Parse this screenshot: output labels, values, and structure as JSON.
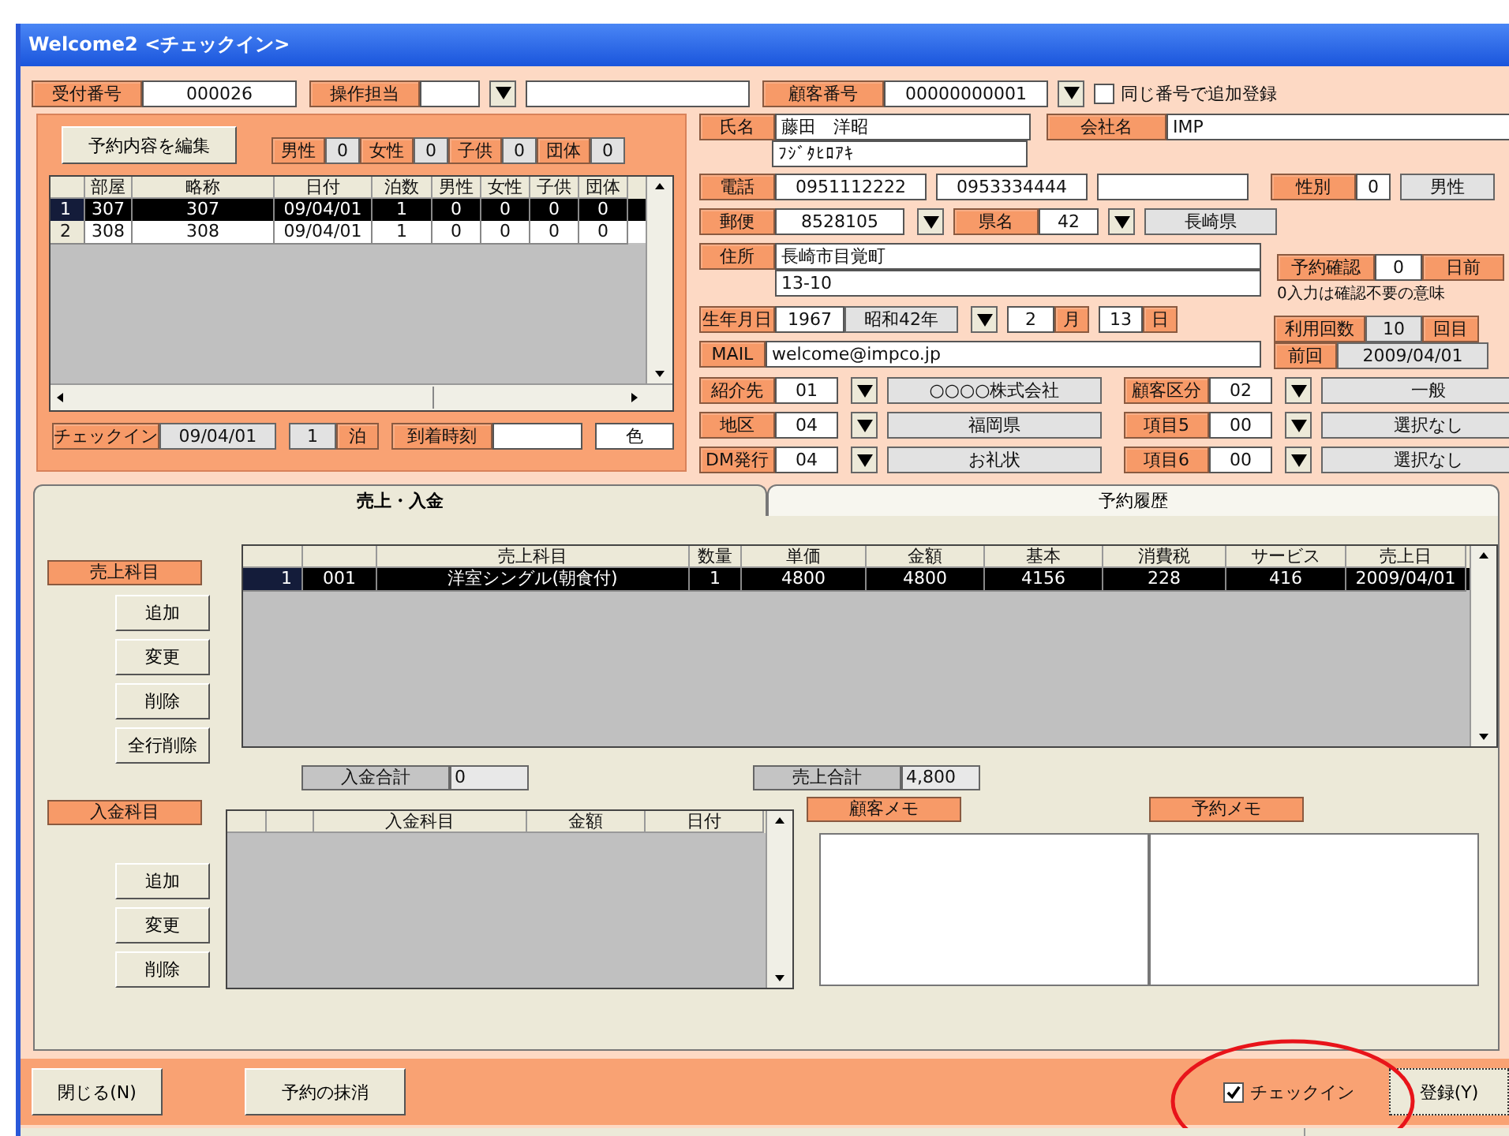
{
  "window": {
    "title": "Welcome2 <チェックイン>"
  },
  "top_bar": {
    "reception": {
      "label": "受付番号",
      "value": "000026"
    },
    "operator": {
      "label": "操作担当"
    },
    "customer_no": {
      "label": "顧客番号",
      "value": "00000000001"
    },
    "same_number": {
      "label": "同じ番号で追加登録",
      "checked": false
    }
  },
  "reservation": {
    "edit_button": "予約内容を編集",
    "counts": [
      {
        "label": "男性",
        "value": "0"
      },
      {
        "label": "女性",
        "value": "0"
      },
      {
        "label": "子供",
        "value": "0"
      },
      {
        "label": "団体",
        "value": "0"
      }
    ],
    "columns": [
      "部屋",
      "略称",
      "日付",
      "泊数",
      "男性",
      "女性",
      "子供",
      "団体"
    ],
    "rows": [
      {
        "no": "1",
        "cells": [
          "307",
          "307",
          "09/04/01",
          "1",
          "0",
          "0",
          "0",
          "0"
        ],
        "selected": true
      },
      {
        "no": "2",
        "cells": [
          "308",
          "308",
          "09/04/01",
          "1",
          "0",
          "0",
          "0",
          "0"
        ],
        "selected": false
      }
    ],
    "checkin_label": "チェックイン",
    "checkin_date": "09/04/01",
    "nights": "1",
    "nights_unit": "泊",
    "arrival_label": "到着時刻",
    "color_label": "色"
  },
  "customer": {
    "name_label": "氏名",
    "name": "藤田　洋昭",
    "kana": "ﾌｼﾞﾀﾋﾛｱｷ",
    "company_label": "会社名",
    "company": "IMP",
    "phone_label": "電話",
    "phones": [
      "0951112222",
      "0953334444"
    ],
    "gender_label": "性別",
    "gender_code": "0",
    "gender": "男性",
    "postal_label": "郵便",
    "postal": "8528105",
    "pref_label": "県名",
    "pref_code": "42",
    "pref": "長崎県",
    "address_label": "住所",
    "address": [
      "長崎市目覚町",
      "13-10"
    ],
    "confirm_label": "予約確認",
    "confirm_value": "0",
    "confirm_unit": "日前",
    "confirm_note": "0入力は確認不要の意味",
    "birth_label": "生年月日",
    "birth_year": "1967",
    "birth_era": "昭和42年",
    "birth_month": "2",
    "month_unit": "月",
    "birth_day": "13",
    "day_unit": "日",
    "visits_label": "利用回数",
    "visits": "10",
    "visits_unit": "回目",
    "last_label": "前回",
    "last": "2009/04/01",
    "mail_label": "MAIL",
    "mail": "welcome@impco.jp",
    "selects": [
      {
        "label": "紹介先",
        "code": "01",
        "value": "○○○○株式会社",
        "label2": "顧客区分",
        "code2": "02",
        "value2": "一般"
      },
      {
        "label": "地区",
        "code": "04",
        "value": "福岡県",
        "label2": "項目5",
        "code2": "00",
        "value2": "選択なし"
      },
      {
        "label": "DM発行",
        "code": "04",
        "value": "お礼状",
        "label2": "項目6",
        "code2": "00",
        "value2": "選択なし"
      }
    ]
  },
  "tabs": [
    {
      "label": "売上・入金",
      "selected": true
    },
    {
      "label": "予約履歴",
      "selected": false
    }
  ],
  "sales": {
    "label": "売上科目",
    "buttons": [
      "追加",
      "変更",
      "削除",
      "全行削除"
    ],
    "columns": [
      "売上科目",
      "数量",
      "単価",
      "金額",
      "基本",
      "消費税",
      "サービス",
      "売上日"
    ],
    "rows": [
      {
        "no": "1",
        "code": "001",
        "cells": [
          "洋室シングル(朝食付)",
          "1",
          "4800",
          "4800",
          "4156",
          "228",
          "416",
          "2009/04/01"
        ],
        "selected": true
      }
    ],
    "total_label": "売上合計",
    "total": "4,800"
  },
  "payments": {
    "label": "入金科目",
    "buttons": [
      "追加",
      "変更",
      "削除"
    ],
    "columns": [
      "入金科目",
      "金額",
      "日付"
    ],
    "total_label": "入金合計",
    "total": "0"
  },
  "memos": [
    {
      "label": "顧客メモ"
    },
    {
      "label": "予約メモ"
    }
  ],
  "footer": {
    "close_button": "閉じる(N)",
    "cancel_button": "予約の抹消",
    "checkin": {
      "label": "チェックイン",
      "checked": true,
      "highlighted": true
    },
    "register_button": "登録(Y)"
  }
}
